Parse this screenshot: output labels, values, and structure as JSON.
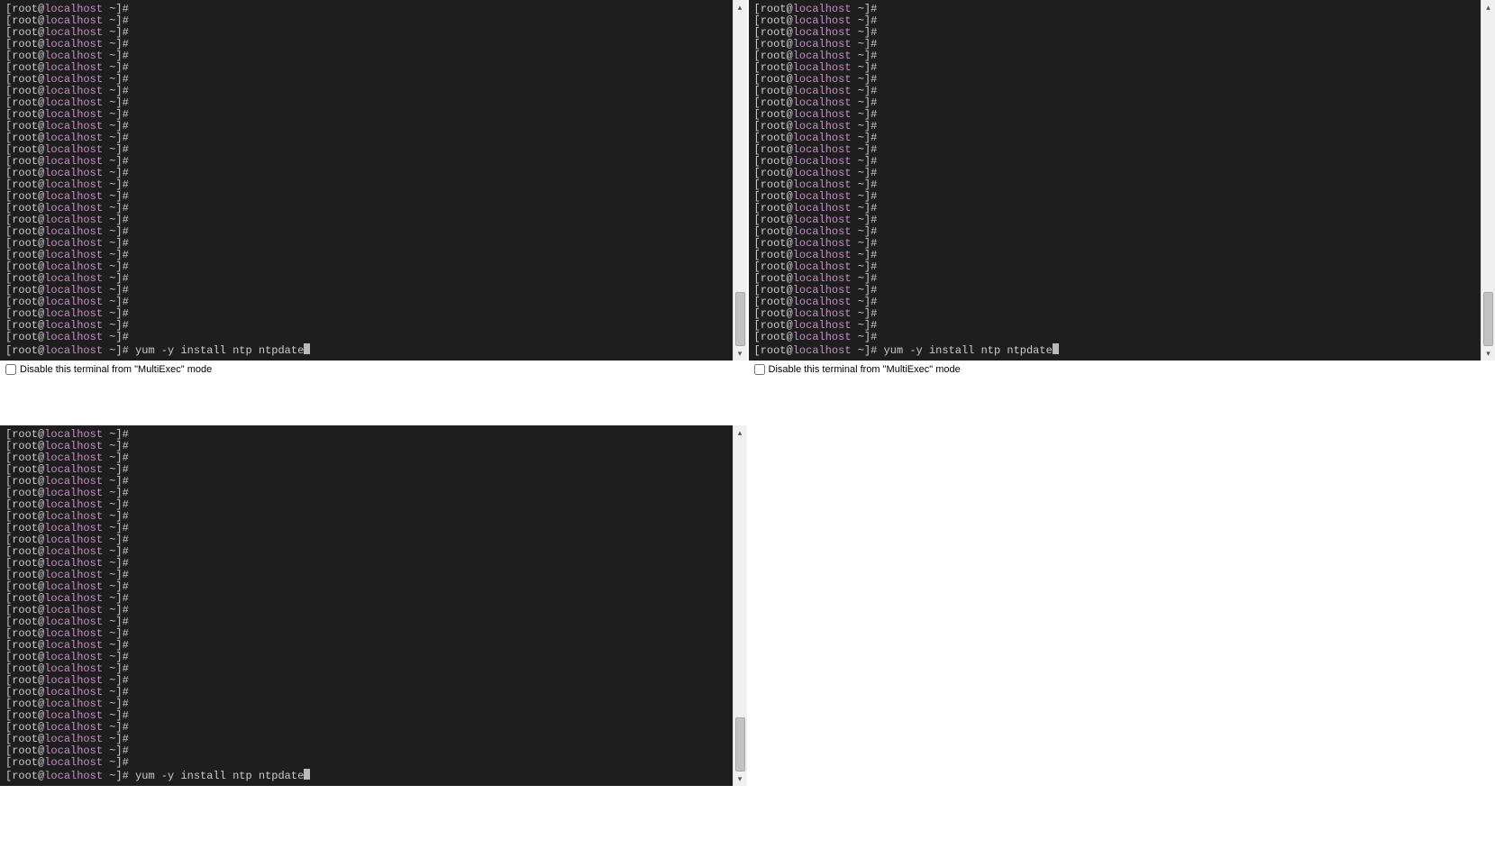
{
  "prompt": {
    "user": "root",
    "at": "@",
    "host": "localhost",
    "path_and_symbol": " ~]#"
  },
  "command": "yum -y install ntp ntpdate",
  "blank_prompt_lines": 29,
  "disable_label": "Disable this terminal from \"MultiExec\" mode",
  "scroll": {
    "arrow_up": "▴",
    "arrow_down": "▾"
  },
  "thumb": {
    "top_pct": 81,
    "height_pct": 15
  },
  "panes": [
    {
      "has_terminal": true,
      "show_disable": true
    },
    {
      "has_terminal": true,
      "show_disable": true
    },
    {
      "has_terminal": true,
      "show_disable": false
    },
    {
      "has_terminal": false,
      "show_disable": false
    }
  ]
}
